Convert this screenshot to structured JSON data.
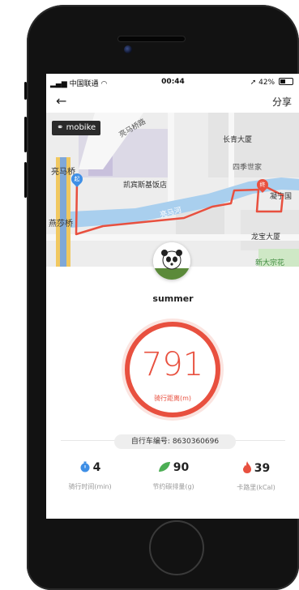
{
  "status_bar": {
    "carrier": "中国联通",
    "time": "00:44",
    "battery": "42%"
  },
  "nav": {
    "share_label": "分享"
  },
  "map": {
    "brand_badge": "mobike",
    "labels": {
      "street_top": "亮马桥路",
      "liangmaqiao": "亮马桥",
      "kempinski": "凯宾斯基饭店",
      "changqing": "长青大厦",
      "four_seasons": "四季世家",
      "liangma_river": "亮马河",
      "yanshaqiao": "燕莎桥",
      "landmark_right": "凝宁国",
      "longbao": "龙宝大厦",
      "xindazonghua": "新大宗花"
    },
    "start_pin": "起",
    "end_pin": "终",
    "route_color": "#e8503f"
  },
  "user": {
    "name": "summer"
  },
  "ride": {
    "distance": "791",
    "distance_label": "骑行距离(m)",
    "bike_no": "自行车编号: 8630360696"
  },
  "stats": [
    {
      "icon": "stopwatch-icon",
      "value": "4",
      "label": "骑行时间(min)",
      "color": "#3f8fe6"
    },
    {
      "icon": "leaf-icon",
      "value": "90",
      "label": "节约碳排量(g)",
      "color": "#4cae54"
    },
    {
      "icon": "flame-icon",
      "value": "39",
      "label": "卡路里(kCal)",
      "color": "#e8503f"
    }
  ]
}
